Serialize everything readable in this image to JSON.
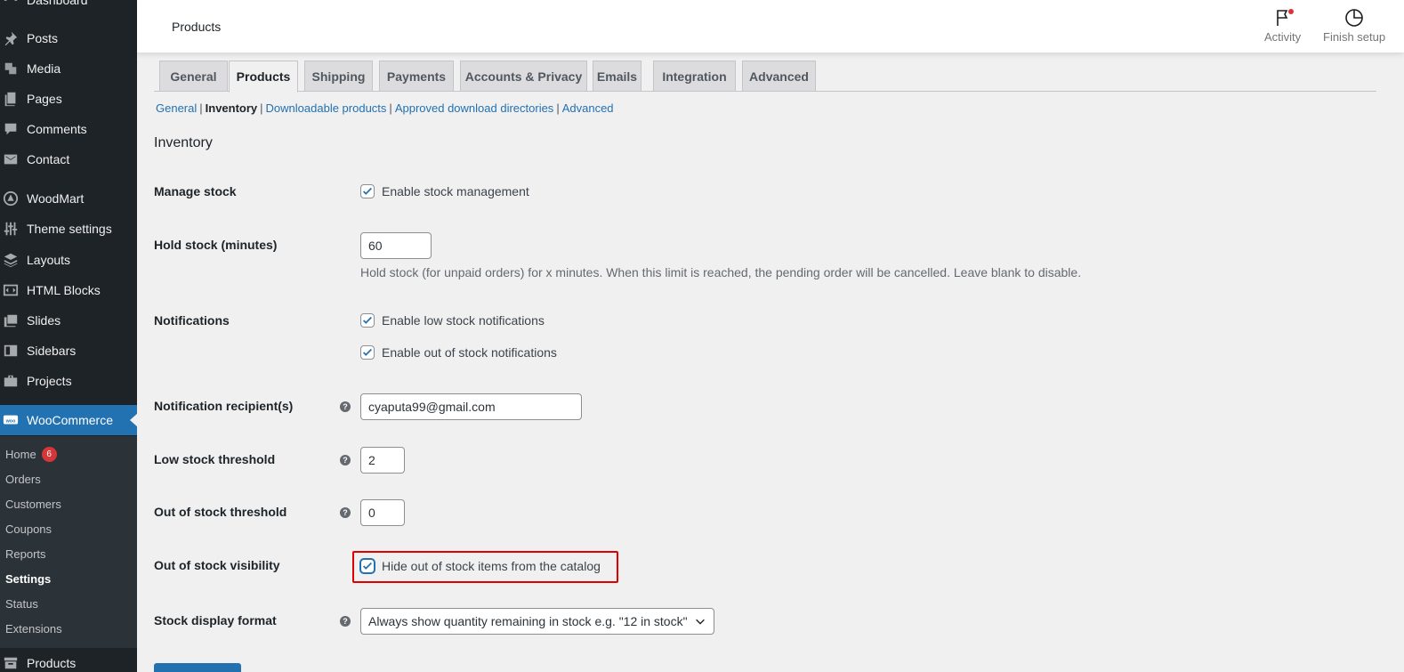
{
  "sidebar": {
    "menu": [
      {
        "label": "Dashboard",
        "icon": "dashboard-icon"
      },
      {
        "label": "Posts",
        "icon": "pin-icon"
      },
      {
        "label": "Media",
        "icon": "media-icon"
      },
      {
        "label": "Pages",
        "icon": "pages-icon"
      },
      {
        "label": "Comments",
        "icon": "comment-icon"
      },
      {
        "label": "Contact",
        "icon": "mail-icon"
      },
      {
        "label": "WoodMart",
        "icon": "woodmart-icon"
      },
      {
        "label": "Theme settings",
        "icon": "sliders-icon"
      },
      {
        "label": "Layouts",
        "icon": "layers-icon"
      },
      {
        "label": "HTML Blocks",
        "icon": "code-block-icon"
      },
      {
        "label": "Slides",
        "icon": "slides-icon"
      },
      {
        "label": "Sidebars",
        "icon": "sidebar-icon"
      },
      {
        "label": "Projects",
        "icon": "briefcase-icon"
      },
      {
        "label": "WooCommerce",
        "icon": "woo-icon"
      },
      {
        "label": "Products",
        "icon": "archive-icon"
      }
    ],
    "submenu": [
      {
        "label": "Home",
        "badge": "6"
      },
      {
        "label": "Orders"
      },
      {
        "label": "Customers"
      },
      {
        "label": "Coupons"
      },
      {
        "label": "Reports"
      },
      {
        "label": "Settings"
      },
      {
        "label": "Status"
      },
      {
        "label": "Extensions"
      }
    ]
  },
  "header": {
    "title": "Products",
    "activity_label": "Activity",
    "finish_setup_label": "Finish setup"
  },
  "tabs": [
    "General",
    "Products",
    "Shipping",
    "Payments",
    "Accounts & Privacy",
    "Emails",
    "Integration",
    "Advanced"
  ],
  "active_tab": "Products",
  "subsections": [
    "General",
    "Inventory",
    "Downloadable products",
    "Approved download directories",
    "Advanced"
  ],
  "current_subsection": "Inventory",
  "section_title": "Inventory",
  "fields": {
    "manage_stock": {
      "label": "Manage stock",
      "checkbox_label": "Enable stock management",
      "checked": true
    },
    "hold_stock": {
      "label": "Hold stock (minutes)",
      "value": "60",
      "description": "Hold stock (for unpaid orders) for x minutes. When this limit is reached, the pending order will be cancelled. Leave blank to disable."
    },
    "notifications": {
      "label": "Notifications",
      "low_stock_label": "Enable low stock notifications",
      "out_of_stock_label": "Enable out of stock notifications"
    },
    "recipient": {
      "label": "Notification recipient(s)",
      "value": "cyaputa99@gmail.com"
    },
    "low_stock_threshold": {
      "label": "Low stock threshold",
      "value": "2"
    },
    "out_of_stock_threshold": {
      "label": "Out of stock threshold",
      "value": "0"
    },
    "visibility": {
      "label": "Out of stock visibility",
      "checkbox_label": "Hide out of stock items from the catalog",
      "checked": true
    },
    "stock_display_format": {
      "label": "Stock display format",
      "value": "Always show quantity remaining in stock e.g. \"12 in stock\""
    }
  },
  "colors": {
    "accent": "#2271b1",
    "sidebar_bg": "#1d2327",
    "highlight": "#e00000",
    "badge": "#d63638"
  }
}
